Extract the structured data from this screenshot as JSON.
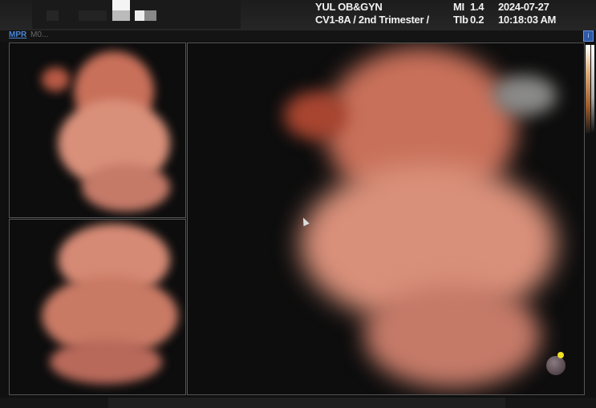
{
  "header": {
    "institution": "YUL OB&GYN",
    "preset": "CV1-8A / 2nd Trimester /",
    "mi_label": "MI",
    "mi_value": "1.4",
    "tib_label": "TIb",
    "tib_value": "0.2",
    "date": "2024-07-27",
    "time": "10:18:03 AM"
  },
  "subbar": {
    "mode_label": "MPR",
    "mode_info": "M0...",
    "info_icon": "i"
  },
  "colors": {
    "tissue": "#d9826a",
    "accent": "#4a86d8",
    "marker": "#f0e020"
  }
}
